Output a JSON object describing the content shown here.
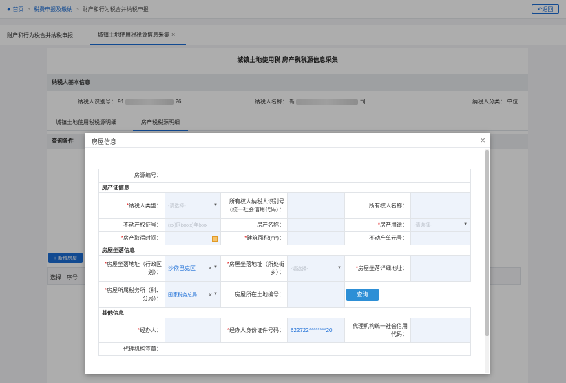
{
  "breadcrumb": {
    "home": "首页",
    "level1": "税费申报及缴纳",
    "current": "财产和行为税合并纳税申报",
    "back": "返回"
  },
  "tabs": [
    {
      "label": "财产和行为税合并纳税申报"
    },
    {
      "label": "城镇土地使用税税源信息采集"
    }
  ],
  "page": {
    "title": "城镇土地使用税 房产税税源信息采集",
    "section_basic": "纳税人基本信息",
    "taxpayer_id_label": "纳税人识别号：",
    "taxpayer_id_prefix": "91",
    "taxpayer_id_suffix": "26",
    "taxpayer_name_label": "纳税人名称：",
    "taxpayer_name_prefix": "新",
    "taxpayer_name_suffix": "司",
    "taxpayer_type_label": "纳税人分类：",
    "taxpayer_type_value": "单位",
    "subtab1": "城镇土地使用税税源明细",
    "subtab2": "房产税税源明细",
    "query_conditions": "查询条件",
    "add_button": "+ 新增房屋",
    "col_select": "选择",
    "col_index": "序号"
  },
  "modal": {
    "title": "房屋信息",
    "close": "×",
    "source_no_label": "房源编号：",
    "sec_cert": "房产证信息",
    "taxpayer_type_label": "纳税人类型：",
    "taxpayer_type_ph": "-请选择-",
    "owner_id_label": "所有权人纳税人识别号（统一社会信用代码）：",
    "owner_name_label": "所有权人名称：",
    "cert_no_label": "不动产权证号：",
    "cert_no_ph": "(xx)区(xxxx)年(xxx",
    "house_name_label": "房产名称：",
    "house_use_label": "房产用途：",
    "house_use_ph": "-请选择-",
    "acquire_time_label": "房产取得时间：",
    "area_label": "建筑面积(m²)：",
    "unit_no_label": "不动产单元号：",
    "sec_location": "房屋坐落信息",
    "district_label": "房屋坐落地址（行政区划）：",
    "district_value": "沙依巴克区",
    "street_label": "房屋坐落地址（所处街乡）：",
    "street_ph": "-请选择-",
    "detail_addr_label": "房屋坐落详细地址：",
    "tax_office_label": "房屋所属税务所（科、分局）：",
    "tax_office_value": "国家税务总局",
    "land_no_label": "房屋所在土地编号：",
    "query_btn": "查询",
    "sec_other": "其他信息",
    "handler_label": "经办人：",
    "handler_id_label": "经办人身份证件号码：",
    "handler_id_value": "622722********20",
    "agency_code_label": "代理机构统一社会信用代码：",
    "agency_seal_label": "代理机构签章："
  }
}
